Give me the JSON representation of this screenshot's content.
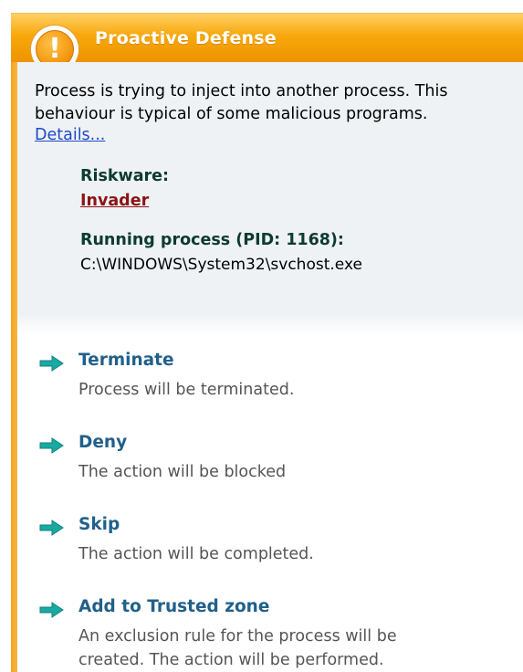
{
  "window": {
    "title": "Proactive Defense",
    "icon": "exclamation-alert-icon",
    "colors": {
      "title_bar": "#f5a60f",
      "info_background": "#eff2f5",
      "link": "#1d49c7",
      "riskware_name": "#8c1414",
      "action_title": "#21608a"
    }
  },
  "alert": {
    "description": "Process is trying to inject into another process. This behaviour is typical of some malicious programs.",
    "details_link": "Details...",
    "riskware_label": "Riskware:",
    "riskware_name": "Invader",
    "process_label": "Running process (PID: 1168):",
    "process_path": "C:\\WINDOWS\\System32\\svchost.exe"
  },
  "actions": [
    {
      "title": "Terminate",
      "description": "Process will be terminated.",
      "icon": "arrow-right-icon"
    },
    {
      "title": "Deny",
      "description": "The action will be blocked",
      "icon": "arrow-right-icon"
    },
    {
      "title": "Skip",
      "description": "The action will be completed.",
      "icon": "arrow-right-icon"
    },
    {
      "title": "Add to Trusted zone",
      "description": "An exclusion rule for the process will be created. The action will be performed.",
      "icon": "arrow-right-icon"
    }
  ]
}
